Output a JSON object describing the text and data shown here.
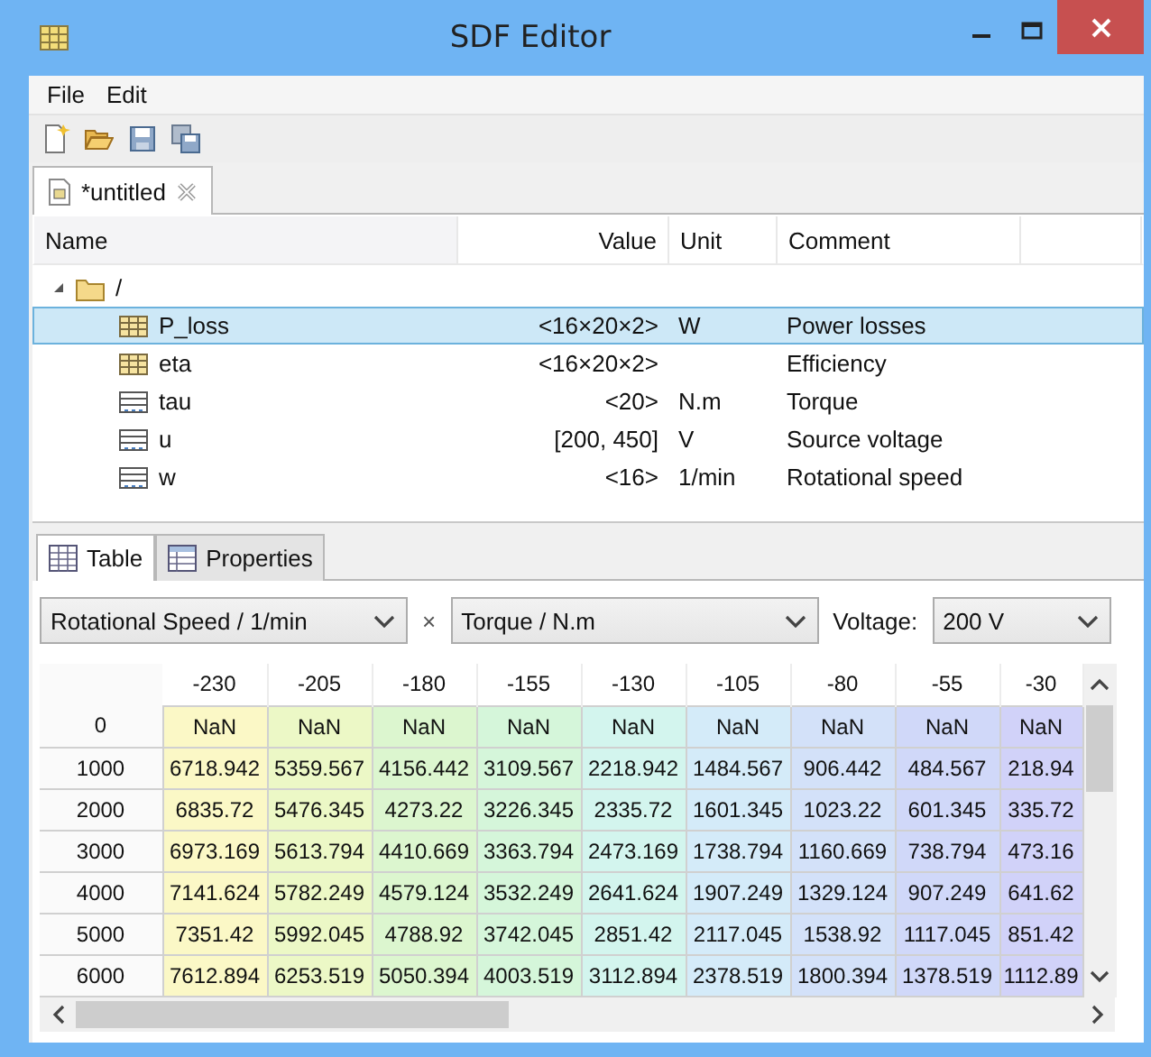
{
  "window": {
    "title": "SDF Editor"
  },
  "menu": [
    "File",
    "Edit"
  ],
  "editor_tab": {
    "label": "*untitled",
    "selected": true
  },
  "tree": {
    "columns": [
      "Name",
      "Value",
      "Unit",
      "Comment"
    ],
    "root": {
      "name": "/",
      "expanded": true,
      "children": [
        {
          "name": "P_loss",
          "kind": "matrix",
          "value": "<16×20×2>",
          "unit": "W",
          "comment": "Power losses",
          "selected": true
        },
        {
          "name": "eta",
          "kind": "matrix",
          "value": "<16×20×2>",
          "comment": "Efficiency",
          "selected": false
        },
        {
          "name": "tau",
          "kind": "vector",
          "value": "<20>",
          "unit": "N.m",
          "comment": "Torque",
          "selected": false
        },
        {
          "name": "u",
          "kind": "vector",
          "value": "[200, 450]",
          "unit": "V",
          "comment": "Source voltage",
          "selected": false
        },
        {
          "name": "w",
          "kind": "vector",
          "value": "<16>",
          "unit": "1/min",
          "comment": "Rotational speed",
          "selected": false
        }
      ]
    }
  },
  "panel_tabs": [
    {
      "label": "Table",
      "kind": "table",
      "selected": true
    },
    {
      "label": "Properties",
      "kind": "properties",
      "selected": false
    }
  ],
  "axes": {
    "row_axis": "Rotational Speed / 1/min",
    "separator": "×",
    "column_axis": "Torque / N.m",
    "voltage_label": "Voltage:",
    "voltage": "200 V"
  },
  "table": {
    "columns": [
      "-230",
      "-205",
      "-180",
      "-155",
      "-130",
      "-105",
      "-80",
      "-55",
      "-30"
    ],
    "rows": [
      {
        "header": "0",
        "cells": [
          "NaN",
          "NaN",
          "NaN",
          "NaN",
          "NaN",
          "NaN",
          "NaN",
          "NaN",
          "NaN"
        ]
      },
      {
        "header": "1000",
        "cells": [
          "6718.942",
          "5359.567",
          "4156.442",
          "3109.567",
          "2218.942",
          "1484.567",
          "906.442",
          "484.567",
          "218.94"
        ]
      },
      {
        "header": "2000",
        "cells": [
          "6835.72",
          "5476.345",
          "4273.22",
          "3226.345",
          "2335.72",
          "1601.345",
          "1023.22",
          "601.345",
          "335.72"
        ]
      },
      {
        "header": "3000",
        "cells": [
          "6973.169",
          "5613.794",
          "4410.669",
          "3363.794",
          "2473.169",
          "1738.794",
          "1160.669",
          "738.794",
          "473.16"
        ]
      },
      {
        "header": "4000",
        "cells": [
          "7141.624",
          "5782.249",
          "4579.124",
          "3532.249",
          "2641.624",
          "1907.249",
          "1329.124",
          "907.249",
          "641.62"
        ]
      },
      {
        "header": "5000",
        "cells": [
          "7351.42",
          "5992.045",
          "4788.92",
          "3742.045",
          "2851.42",
          "2117.045",
          "1538.92",
          "1117.045",
          "851.42"
        ]
      },
      {
        "header": "6000",
        "cells": [
          "7612.894",
          "6253.519",
          "5050.394",
          "4003.519",
          "3112.894",
          "2378.519",
          "1800.394",
          "1378.519",
          "1112.89"
        ]
      }
    ]
  }
}
